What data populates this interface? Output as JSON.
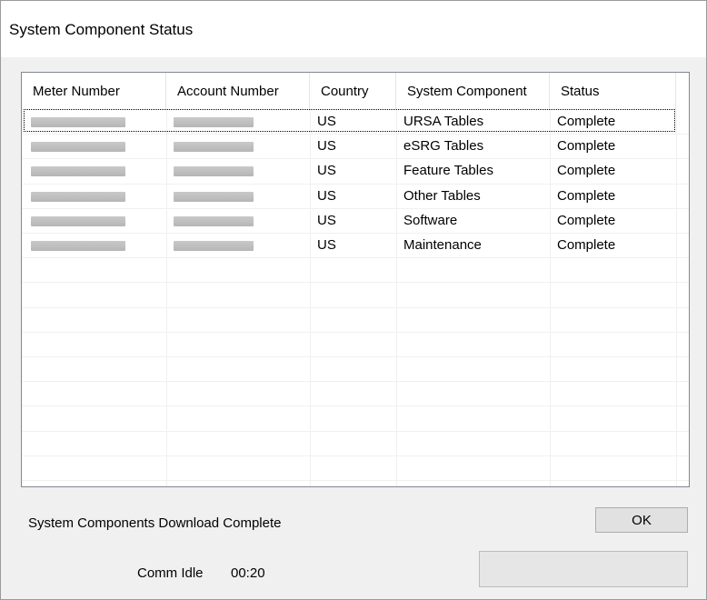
{
  "window": {
    "title": "System Component Status"
  },
  "table": {
    "columns": [
      "Meter Number",
      "Account Number",
      "Country",
      "System Component",
      "Status"
    ],
    "rows": [
      {
        "meter_number": "[redacted]",
        "account_number": "[redacted]",
        "country": "US",
        "component": "URSA Tables",
        "status": "Complete"
      },
      {
        "meter_number": "[redacted]",
        "account_number": "[redacted]",
        "country": "US",
        "component": "eSRG Tables",
        "status": "Complete"
      },
      {
        "meter_number": "[redacted]",
        "account_number": "[redacted]",
        "country": "US",
        "component": "Feature Tables",
        "status": "Complete"
      },
      {
        "meter_number": "[redacted]",
        "account_number": "[redacted]",
        "country": "US",
        "component": "Other Tables",
        "status": "Complete"
      },
      {
        "meter_number": "[redacted]",
        "account_number": "[redacted]",
        "country": "US",
        "component": "Software",
        "status": "Complete"
      },
      {
        "meter_number": "[redacted]",
        "account_number": "[redacted]",
        "country": "US",
        "component": "Maintenance",
        "status": "Complete"
      }
    ]
  },
  "footer": {
    "status_message": "System Components Download Complete",
    "ok_label": "OK",
    "comm_label": "Comm Idle",
    "comm_time": "00:20",
    "progress_fraction": 0
  }
}
